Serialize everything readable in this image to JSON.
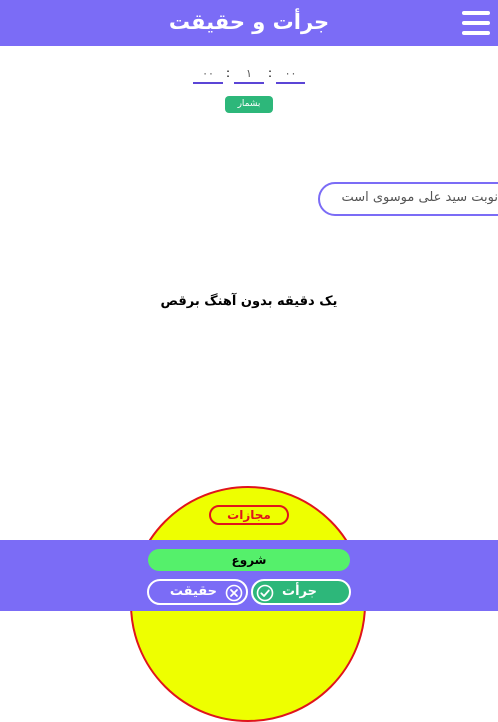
{
  "header": {
    "title": "جرأت و حقیقت",
    "menu_icon": "hamburger-menu-icon"
  },
  "timer": {
    "hours": "۰۰",
    "minutes": "۱",
    "seconds": "۰۰",
    "separator": ":",
    "count_label": "بشمار"
  },
  "turn": {
    "text": "نوبت سید علی موسوی است"
  },
  "challenge": {
    "text": "یک دقیقه بدون آهنگ برقص"
  },
  "punishment": {
    "label": "مجازات"
  },
  "footer": {
    "start_label": "شروع",
    "truth_label": "حقیقت",
    "truth_icon": "close-circle-icon",
    "dare_label": "جرأت",
    "dare_icon": "check-circle-icon"
  },
  "colors": {
    "primary": "#7b6cf6",
    "green": "#2db77a",
    "start_green": "#55f06b",
    "punishment_fill": "#eeff00",
    "punishment_border": "#e0141c"
  }
}
